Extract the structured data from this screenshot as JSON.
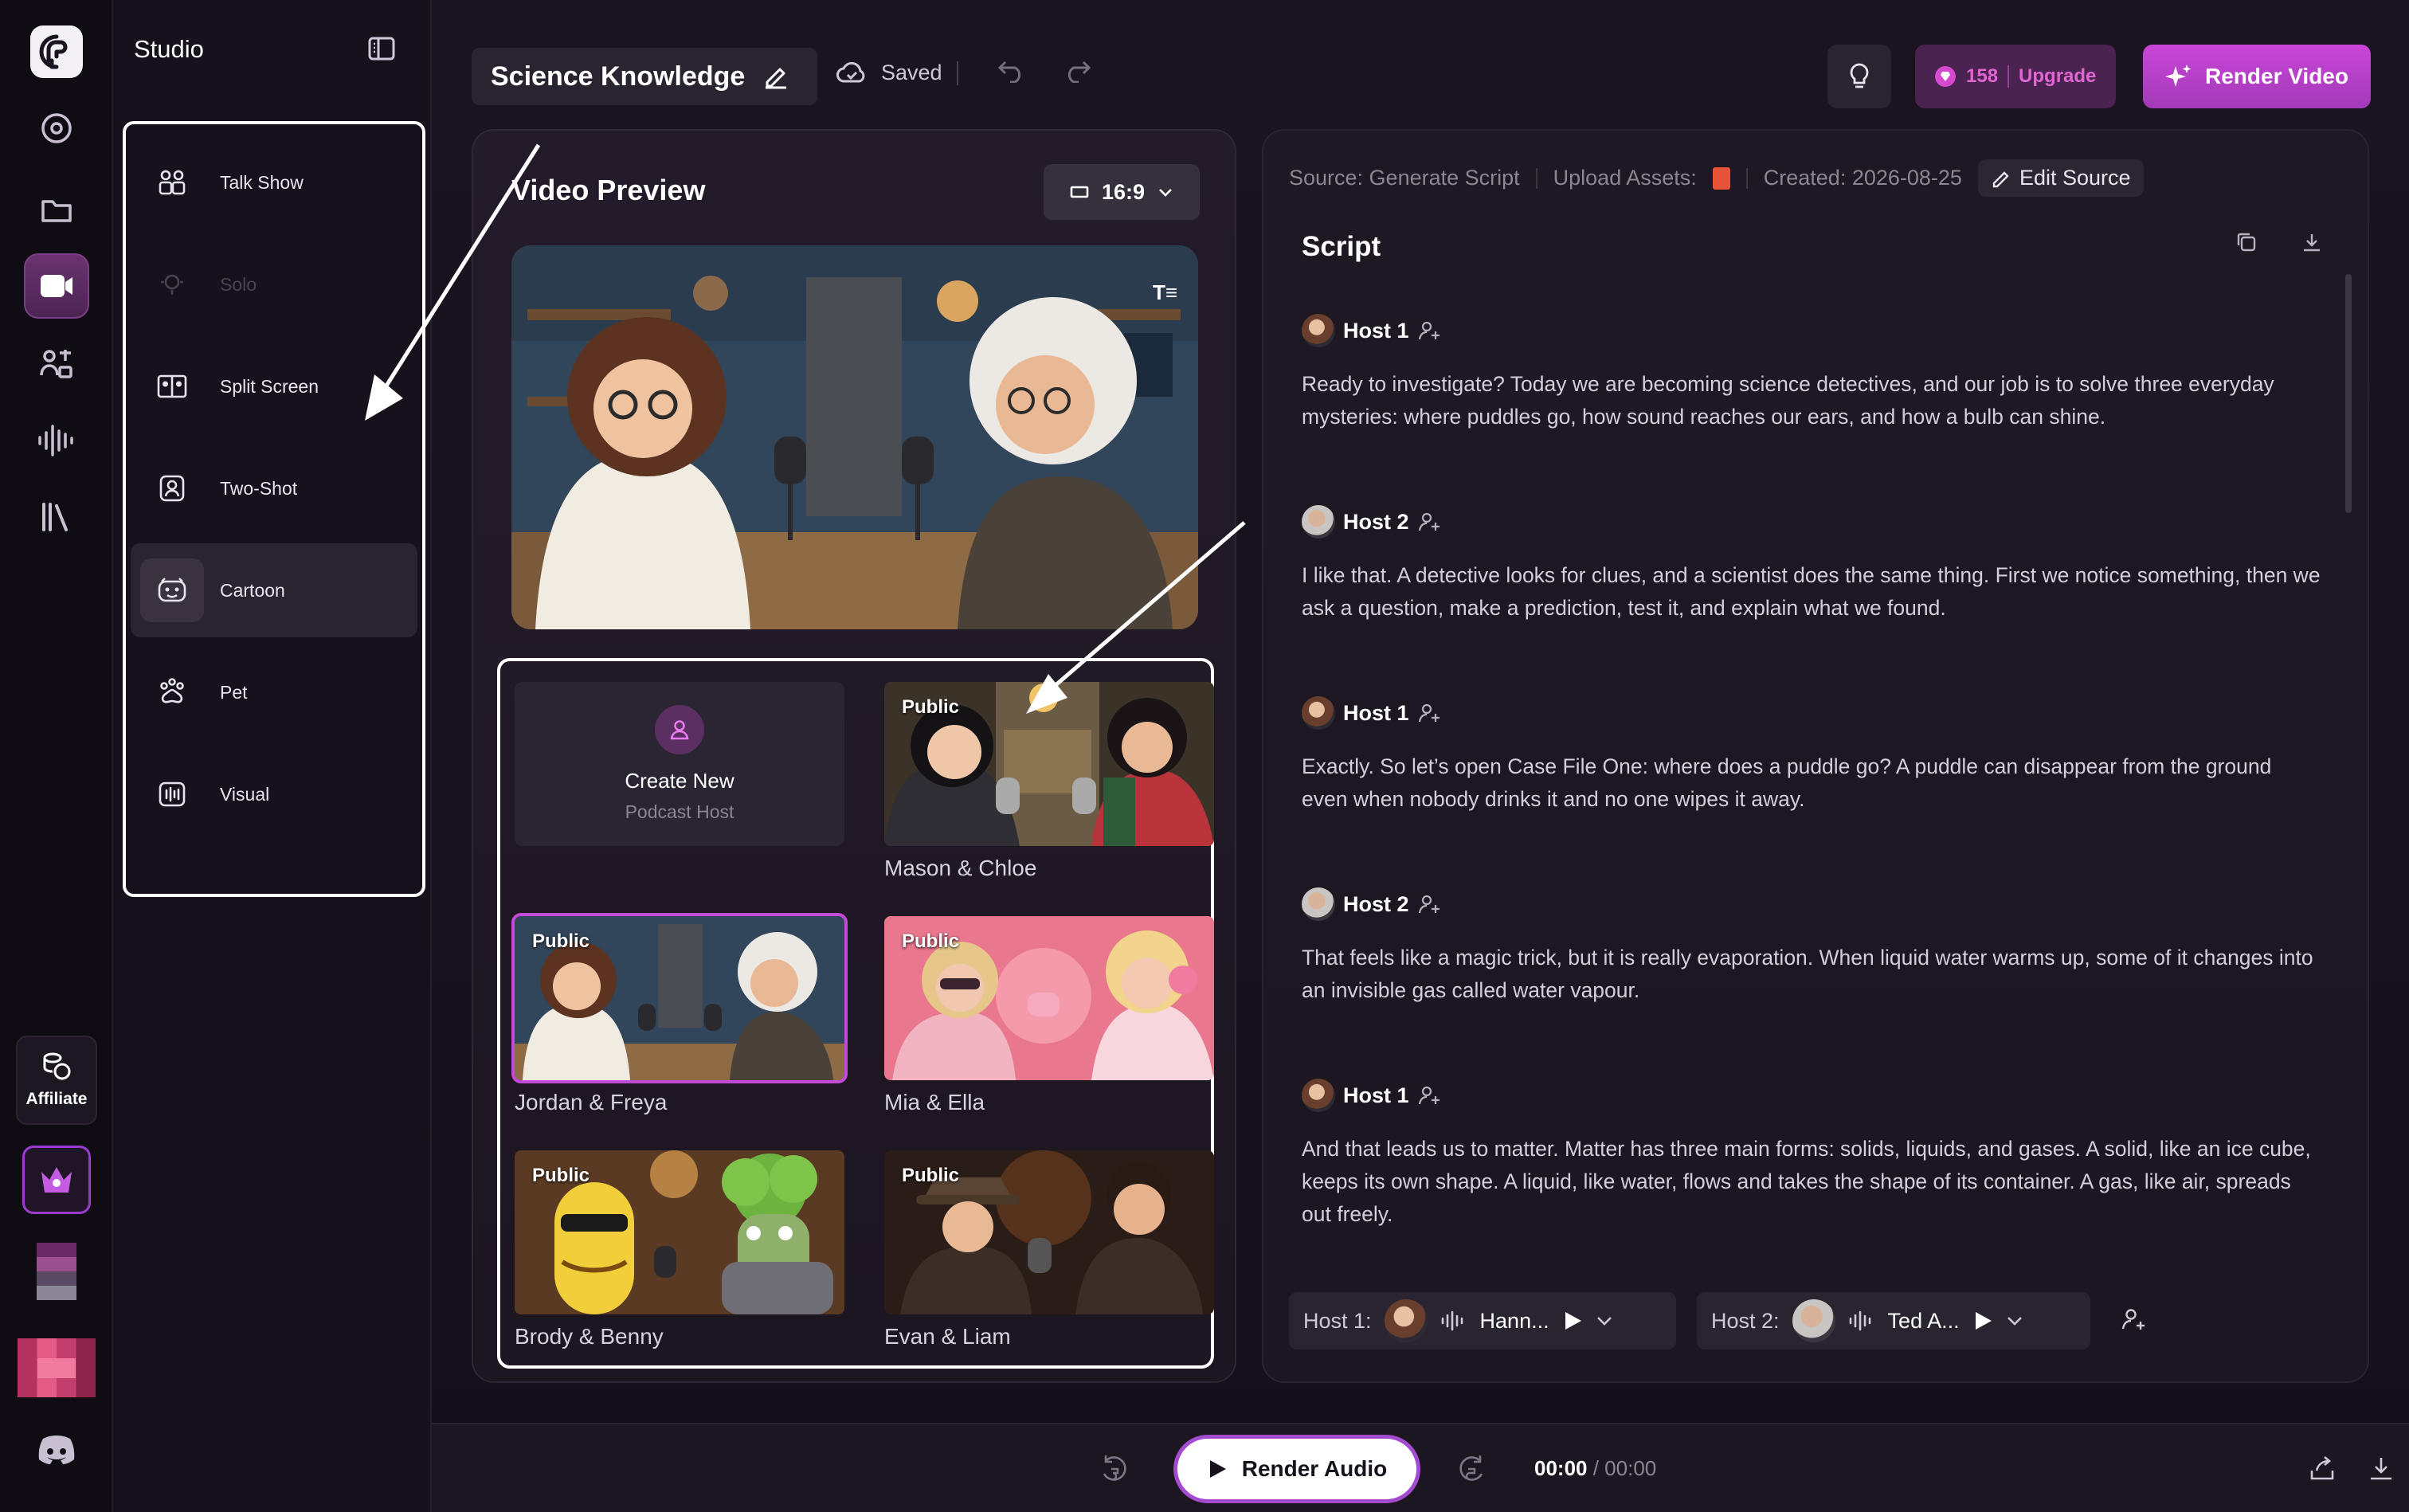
{
  "studio": {
    "title": "Studio",
    "modes": [
      {
        "label": "Talk Show",
        "icon": "talk-show-icon",
        "state": "normal"
      },
      {
        "label": "Solo",
        "icon": "solo-icon",
        "state": "disabled"
      },
      {
        "label": "Split Screen",
        "icon": "split-screen-icon",
        "state": "normal"
      },
      {
        "label": "Two-Shot",
        "icon": "two-shot-icon",
        "state": "normal"
      },
      {
        "label": "Cartoon",
        "icon": "cartoon-icon",
        "state": "selected"
      },
      {
        "label": "Pet",
        "icon": "paw-icon",
        "state": "normal"
      },
      {
        "label": "Visual",
        "icon": "visual-icon",
        "state": "normal"
      }
    ]
  },
  "rail": {
    "affiliate_label": "Affiliate"
  },
  "toolbar": {
    "doc_title": "Science Knowledge",
    "saved_label": "Saved",
    "credits": "158",
    "upgrade_label": "Upgrade",
    "render_video_label": "Render Video"
  },
  "video_preview": {
    "title": "Video Preview",
    "aspect_ratio": "16:9",
    "overlay_glyph": "T≡",
    "create_new": {
      "line1": "Create New",
      "line2": "Podcast Host"
    },
    "hosts": [
      {
        "name": "Mason & Chloe",
        "badge": "Public"
      },
      {
        "name": "Jordan & Freya",
        "badge": "Public",
        "selected": true
      },
      {
        "name": "Mia & Ella",
        "badge": "Public"
      },
      {
        "name": "Brody & Benny",
        "badge": "Public"
      },
      {
        "name": "Evan & Liam",
        "badge": "Public"
      }
    ]
  },
  "script": {
    "source": "Source: Generate Script",
    "upload_assets": "Upload Assets:",
    "created": "Created: 2026-08-25",
    "edit_source_label": "Edit Source",
    "title": "Script",
    "entries": [
      {
        "speaker": "Host 1",
        "text": "Ready to investigate? Today we are becoming science detectives, and our job is to solve three everyday mysteries: where puddles go, how sound reaches our ears, and how a bulb can shine."
      },
      {
        "speaker": "Host 2",
        "text": "I like that. A detective looks for clues, and a scientist does the same thing. First we notice something, then we ask a question, make a prediction, test it, and explain what we found."
      },
      {
        "speaker": "Host 1",
        "text": "Exactly. So let’s open Case File One: where does a puddle go? A puddle can disappear from the ground even when nobody drinks it and no one wipes it away."
      },
      {
        "speaker": "Host 2",
        "text": "That feels like a magic trick, but it is really evaporation. When liquid water warms up, some of it changes into an invisible gas called water vapour."
      },
      {
        "speaker": "Host 1",
        "text": "And that leads us to matter. Matter has three main forms: solids, liquids, and gases. A solid, like an ice cube, keeps its own shape. A liquid, like water, flows and takes the shape of its container. A gas, like air, spreads out freely."
      }
    ],
    "voices": [
      {
        "label": "Host 1:",
        "voice": "Hann..."
      },
      {
        "label": "Host 2:",
        "voice": "Ted A..."
      }
    ]
  },
  "player": {
    "render_audio_label": "Render Audio",
    "current": "00:00",
    "total": "/ 00:00"
  },
  "colors": {
    "accent": "#c945d8",
    "background": "#17121d"
  }
}
